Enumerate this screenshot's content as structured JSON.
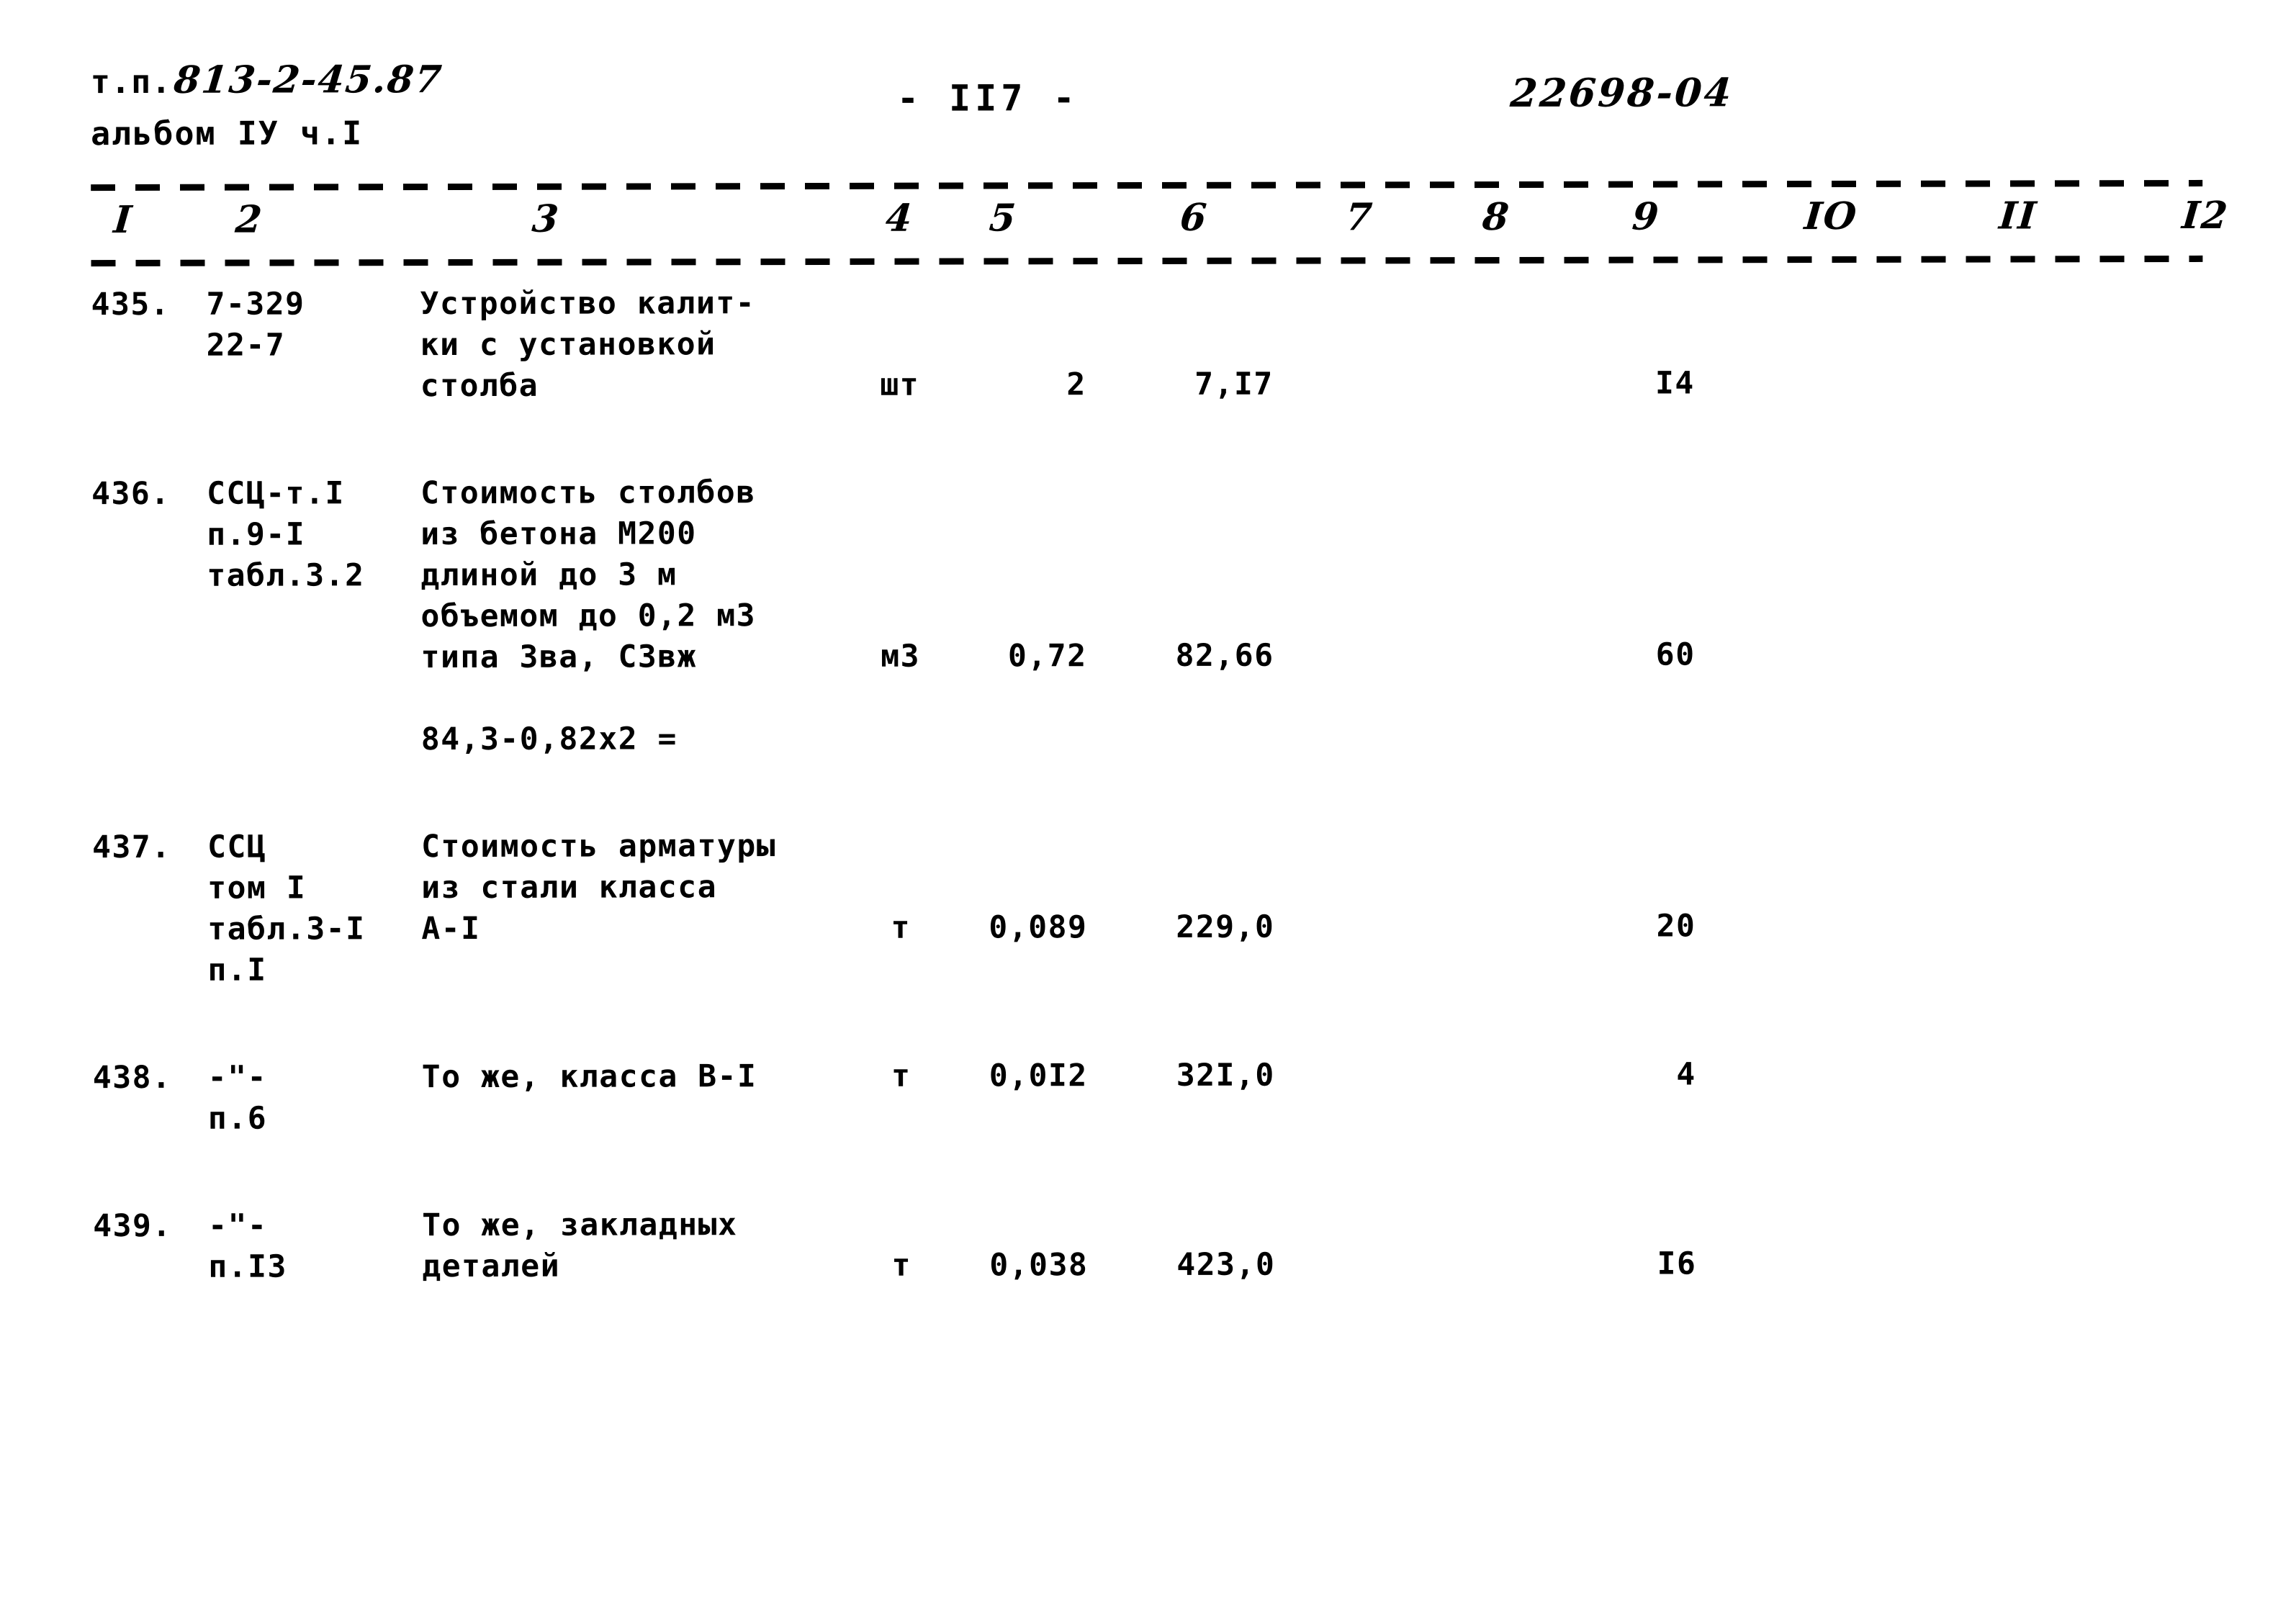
{
  "header": {
    "project_prefix": "т.п.",
    "project_code": "813-2-45.87",
    "album_line": "альбом IУ ч.I",
    "page_number": "- II7 -",
    "doc_number": "22698-04"
  },
  "table": {
    "column_numbers": [
      "I",
      "2",
      "3",
      "4",
      "5",
      "6",
      "7",
      "8",
      "9",
      "IO",
      "II",
      "I2"
    ],
    "rows": [
      {
        "number": "435.",
        "justification": [
          "7-329",
          "22-7"
        ],
        "description": [
          "Устройство калит-",
          "ки с установкой",
          "столба"
        ],
        "unit": "шт",
        "quantity": "2",
        "price": "7,I7",
        "col7": "",
        "col8": "",
        "col9": "I4",
        "col10": "",
        "col11": "",
        "col12": "",
        "value_line_index": 2,
        "formula": ""
      },
      {
        "number": "436.",
        "justification": [
          "ССЦ-т.I",
          "п.9-I",
          "табл.3.2"
        ],
        "description": [
          "Стоимость столбов",
          "из бетона М200",
          "длиной до 3 м",
          "объемом до 0,2 м3",
          "типа Зва, СЗвж"
        ],
        "unit": "м3",
        "quantity": "0,72",
        "price": "82,66",
        "col7": "",
        "col8": "",
        "col9": "60",
        "col10": "",
        "col11": "",
        "col12": "",
        "value_line_index": 4,
        "formula": "84,3-0,82х2 ="
      },
      {
        "number": "437.",
        "justification": [
          "ССЦ",
          "том I",
          "табл.3-I",
          "п.I"
        ],
        "description": [
          "Стоимость арматуры",
          "из стали класса",
          "А-I"
        ],
        "unit": "т",
        "quantity": "0,089",
        "price": "229,0",
        "col7": "",
        "col8": "",
        "col9": "20",
        "col10": "",
        "col11": "",
        "col12": "",
        "value_line_index": 2,
        "formula": ""
      },
      {
        "number": "438.",
        "justification": [
          "-\"-",
          "п.6"
        ],
        "description": [
          "То же, класса В-I"
        ],
        "unit": "т",
        "quantity": "0,0I2",
        "price": "32I,0",
        "col7": "",
        "col8": "",
        "col9": "4",
        "col10": "",
        "col11": "",
        "col12": "",
        "value_line_index": 0,
        "formula": ""
      },
      {
        "number": "439.",
        "justification": [
          "-\"-",
          "п.I3"
        ],
        "description": [
          "То же, закладных",
          "деталей"
        ],
        "unit": "т",
        "quantity": "0,038",
        "price": "423,0",
        "col7": "",
        "col8": "",
        "col9": "I6",
        "col10": "",
        "col11": "",
        "col12": "",
        "value_line_index": 1,
        "formula": ""
      }
    ]
  }
}
